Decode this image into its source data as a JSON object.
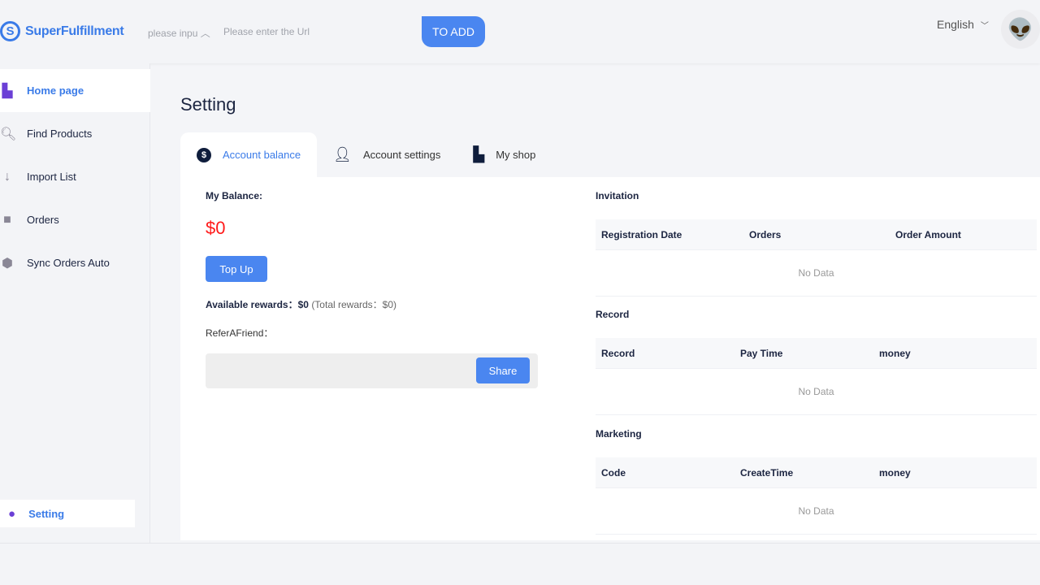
{
  "header": {
    "brand": "SuperFulfillment",
    "select_value": "please inpu",
    "url_placeholder": "Please enter the Url",
    "add_label": "TO ADD",
    "language": "English",
    "avatar": "👽"
  },
  "sidebar": {
    "items": [
      {
        "label": "Home page",
        "icon": "store-icon"
      },
      {
        "label": "Find Products",
        "icon": "search-icon"
      },
      {
        "label": "Import List",
        "icon": "arrow-down-icon"
      },
      {
        "label": "Orders",
        "icon": "bag-icon"
      },
      {
        "label": "Sync Orders Auto",
        "icon": "box-icon"
      }
    ],
    "setting": "Setting"
  },
  "page": {
    "title": "Setting",
    "tabs": [
      {
        "label": "Account balance"
      },
      {
        "label": "Account settings"
      },
      {
        "label": "My shop"
      }
    ]
  },
  "balance": {
    "label": "My Balance:",
    "amount": "$0",
    "top_up": "Top Up",
    "rewards_label": "Available rewards：",
    "rewards_value": "$0",
    "total_rewards": "(Total rewards：$0)",
    "refer_label": "ReferAFriend：",
    "share": "Share",
    "amount_color": "#ff1a1a"
  },
  "invitation": {
    "title": "Invitation",
    "columns": [
      "Registration Date",
      "Orders",
      "Order Amount"
    ],
    "empty": "No Data"
  },
  "record": {
    "title": "Record",
    "columns": [
      "Record",
      "Pay Time",
      "money"
    ],
    "empty": "No Data"
  },
  "marketing": {
    "title": "Marketing",
    "columns": [
      "Code",
      "CreateTime",
      "money"
    ],
    "empty": "No Data"
  },
  "colors": {
    "accent": "#4a86f0"
  }
}
